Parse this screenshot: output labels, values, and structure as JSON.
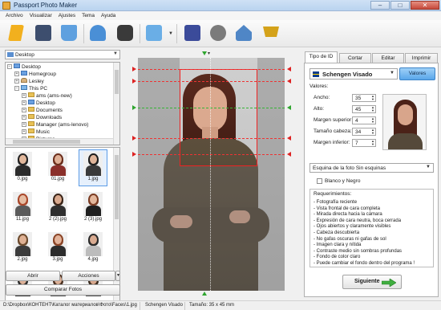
{
  "window": {
    "title": "Passport Photo Maker",
    "controls": [
      "–",
      "□",
      "✕"
    ]
  },
  "menu": [
    "Archivo",
    "Visualizar",
    "Ajustes",
    "Tema",
    "Ayuda"
  ],
  "toolbar": {
    "buttons": [
      {
        "icon": "open-wizard-icon",
        "color": "#f2b01e"
      },
      {
        "icon": "save-icon",
        "color": "#3d4e6e"
      },
      {
        "icon": "print-icon",
        "color": "#5ea0df"
      },
      {
        "icon": "user-icon",
        "color": "#4a8fd6"
      },
      {
        "icon": "camera-icon",
        "color": "#3a3a3a"
      },
      {
        "icon": "photo-editor-icon",
        "color": "#6aaee6"
      },
      {
        "icon": "help-book-icon",
        "color": "#3b4b9a"
      },
      {
        "icon": "film-reel-icon",
        "color": "#7b7b7b"
      },
      {
        "icon": "home-icon",
        "color": "#4f86c6"
      },
      {
        "icon": "shopping-cart-icon",
        "color": "#d4a21a"
      }
    ]
  },
  "left_panel": {
    "folder_select": "Desktop",
    "tree": [
      {
        "label": "Desktop",
        "level": 0,
        "icon": "blue"
      },
      {
        "label": "Homegroup",
        "level": 1,
        "icon": "blue"
      },
      {
        "label": "Lesley",
        "level": 1,
        "icon": "user"
      },
      {
        "label": "This PC",
        "level": 1,
        "icon": "pc"
      },
      {
        "label": "ams (ams-new)",
        "level": 2,
        "icon": "folder"
      },
      {
        "label": "Desktop",
        "level": 2,
        "icon": "blue"
      },
      {
        "label": "Documents",
        "level": 2,
        "icon": "folder"
      },
      {
        "label": "Downloads",
        "level": 2,
        "icon": "folder"
      },
      {
        "label": "Manager (ams-lenovo)",
        "level": 2,
        "icon": "folder"
      },
      {
        "label": "Music",
        "level": 2,
        "icon": "folder"
      },
      {
        "label": "Pictures",
        "level": 2,
        "icon": "folder"
      }
    ],
    "thumbnails": [
      {
        "label": "0.jpg",
        "hair": "#222222",
        "body": "#2b2b2b",
        "skin": "#e2b89c"
      },
      {
        "label": "01.jpg",
        "hair": "#6b2d1b",
        "body": "#8a2f2a",
        "skin": "#dfb096"
      },
      {
        "label": "1.jpg",
        "hair": "#1d1d1d",
        "body": "#3a3a3a",
        "skin": "#e0b59a"
      },
      {
        "label": "11.jpg",
        "hair": "#a9472a",
        "body": "#5a5a5a",
        "skin": "#e6bda3"
      },
      {
        "label": "2 (2).jpg",
        "hair": "#3a2418",
        "body": "#2f2f2f",
        "skin": "#d9a98e"
      },
      {
        "label": "2 (3).jpg",
        "hair": "#7a3b22",
        "body": "#1f1f1f",
        "skin": "#e3b79c"
      },
      {
        "label": "2.jpg",
        "hair": "#6b4a2d",
        "body": "#3c3c3c",
        "skin": "#dfb194"
      },
      {
        "label": "3.jpg",
        "hair": "#8a4426",
        "body": "#2d2d2d",
        "skin": "#e2b39a"
      },
      {
        "label": "4.jpg",
        "hair": "#2a2a2a",
        "body": "#bcbcbc",
        "skin": "#d9ab91"
      },
      {
        "label": "",
        "hair": "#2c2c2c",
        "body": "#2c2c2c",
        "skin": "#ddb197"
      },
      {
        "label": "",
        "hair": "#4a3020",
        "body": "#4d4d4d",
        "skin": "#ddb197"
      },
      {
        "label": "",
        "hair": "#3a2a1d",
        "body": "#4a4a4a",
        "skin": "#d8a88d"
      }
    ],
    "btn_open": "Abrir",
    "btn_actions": "Acciones",
    "btn_compare": "Comparar Fotos"
  },
  "right_panel": {
    "tabs": [
      "Tipo de ID",
      "Cortar",
      "Editar",
      "Imprimir"
    ],
    "visa_type": "Schengen Visado",
    "btn_values": "Valores",
    "values_heading": "Valores:",
    "fields": [
      {
        "label": "Ancho:",
        "value": "35"
      },
      {
        "label": "Alto:",
        "value": "45"
      },
      {
        "label": "Margen superior:",
        "value": "4"
      },
      {
        "label": "Tamaño cabeza:",
        "value": "34"
      },
      {
        "label": "Margen inferior:",
        "value": "7"
      }
    ],
    "corner_select": "Esquina de la foto Sin esquinas",
    "bw_label": "Blanco y Negro",
    "bw_checked": false,
    "requirements_title": "Requerimientos:",
    "requirements": [
      "- Fotografía reciente",
      "- Vista frontal de cara completa",
      "- Mirada directa hacia la cámara",
      "- Expresión de cara neutra, boca cerrada",
      "- Ojos abiertos y claramente visibles",
      "- Cabeza descubierta",
      "- No gafas oscuras ni gafas de sol",
      "- Imagen clara y nítida",
      "- Contraste medio sin sombras profundas",
      "- Fondo de color claro",
      "- Puede cambiar el fondo dentro del programa !"
    ],
    "btn_next": "Siguiente"
  },
  "statusbar": {
    "path": "D:\\Dropbox\\КОНТЕНТ\\Каталог материалов\\Фото\\Faces\\1.jpg",
    "visa": "Schengen Visado",
    "size": "Tamaño: 35 x 45 mm"
  },
  "colors": {
    "guide_red": "#e33333",
    "guide_green": "#35b435",
    "accent_blue": "#5aa6ea"
  }
}
